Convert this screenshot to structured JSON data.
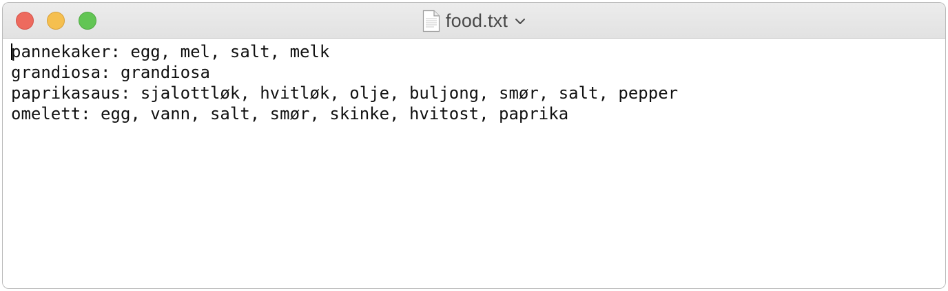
{
  "window": {
    "title": "food.txt",
    "title_icon": "document-icon",
    "title_chevron": "chevron-down-icon"
  },
  "colors": {
    "close": "#ed6a5e",
    "minimize": "#f5bf4f",
    "zoom": "#62c554"
  },
  "editor": {
    "lines": [
      "pannekaker: egg, mel, salt, melk",
      "grandiosa: grandiosa",
      "paprikasaus: sjalottløk, hvitløk, olje, buljong, smør, salt, pepper",
      "omelett: egg, vann, salt, smør, skinke, hvitost, paprika"
    ]
  }
}
